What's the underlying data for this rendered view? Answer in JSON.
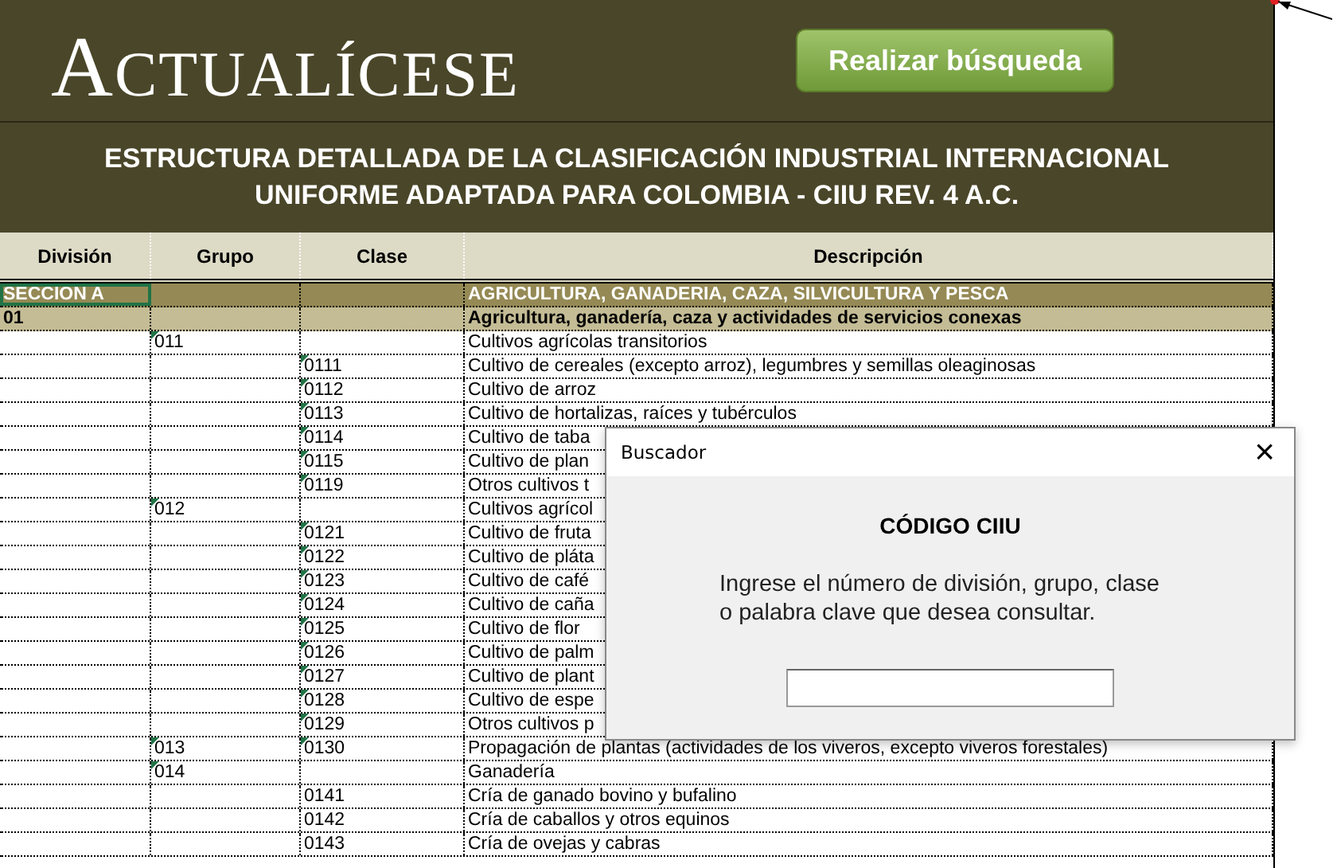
{
  "header": {
    "logo": "ACTUALÍCESE",
    "search_button": "Realizar búsqueda",
    "title_lines": [
      "ESTRUCTURA DETALLADA DE LA CLASIFICACIÓN INDUSTRIAL INTERNACIONAL",
      "UNIFORME ADAPTADA PARA COLOMBIA - CIIU REV. 4 A.C."
    ]
  },
  "table": {
    "columns": [
      "División",
      "Grupo",
      "Clase",
      "Descripción"
    ],
    "rows": [
      {
        "kind": "section",
        "division": "SECCION A",
        "grupo": "",
        "clase": "",
        "descripcion": "AGRICULTURA, GANADERIA, CAZA, SILVICULTURA Y PESCA",
        "grupo_flag": false,
        "clase_flag": false,
        "selected": true
      },
      {
        "kind": "division",
        "division": "01",
        "grupo": "",
        "clase": "",
        "descripcion": "Agricultura, ganadería, caza y actividades de servicios conexas",
        "grupo_flag": false,
        "clase_flag": false,
        "selected": false
      },
      {
        "kind": "item",
        "division": "",
        "grupo": "011",
        "clase": "",
        "descripcion": "Cultivos agrícolas transitorios",
        "grupo_flag": true,
        "clase_flag": false,
        "selected": false
      },
      {
        "kind": "item",
        "division": "",
        "grupo": "",
        "clase": "0111",
        "descripcion": "Cultivo de cereales (excepto arroz), legumbres y semillas oleaginosas",
        "grupo_flag": false,
        "clase_flag": true,
        "selected": false
      },
      {
        "kind": "item",
        "division": "",
        "grupo": "",
        "clase": "0112",
        "descripcion": "Cultivo de arroz",
        "grupo_flag": false,
        "clase_flag": true,
        "selected": false
      },
      {
        "kind": "item",
        "division": "",
        "grupo": "",
        "clase": "0113",
        "descripcion": "Cultivo de hortalizas, raíces y tubérculos",
        "grupo_flag": false,
        "clase_flag": true,
        "selected": false
      },
      {
        "kind": "item",
        "division": "",
        "grupo": "",
        "clase": "0114",
        "descripcion": "Cultivo de taba",
        "grupo_flag": false,
        "clase_flag": true,
        "selected": false
      },
      {
        "kind": "item",
        "division": "",
        "grupo": "",
        "clase": "0115",
        "descripcion": "Cultivo de plan",
        "grupo_flag": false,
        "clase_flag": true,
        "selected": false
      },
      {
        "kind": "item",
        "division": "",
        "grupo": "",
        "clase": "0119",
        "descripcion": "Otros cultivos t",
        "grupo_flag": false,
        "clase_flag": true,
        "selected": false
      },
      {
        "kind": "item",
        "division": "",
        "grupo": "012",
        "clase": "",
        "descripcion": "Cultivos agrícol",
        "grupo_flag": true,
        "clase_flag": false,
        "selected": false
      },
      {
        "kind": "item",
        "division": "",
        "grupo": "",
        "clase": "0121",
        "descripcion": "Cultivo de fruta",
        "grupo_flag": false,
        "clase_flag": true,
        "selected": false
      },
      {
        "kind": "item",
        "division": "",
        "grupo": "",
        "clase": "0122",
        "descripcion": "Cultivo de pláta",
        "grupo_flag": false,
        "clase_flag": true,
        "selected": false
      },
      {
        "kind": "item",
        "division": "",
        "grupo": "",
        "clase": "0123",
        "descripcion": "Cultivo de café",
        "grupo_flag": false,
        "clase_flag": true,
        "selected": false
      },
      {
        "kind": "item",
        "division": "",
        "grupo": "",
        "clase": "0124",
        "descripcion": "Cultivo de caña",
        "grupo_flag": false,
        "clase_flag": true,
        "selected": false
      },
      {
        "kind": "item",
        "division": "",
        "grupo": "",
        "clase": "0125",
        "descripcion": "Cultivo de flor",
        "grupo_flag": false,
        "clase_flag": true,
        "selected": false
      },
      {
        "kind": "item",
        "division": "",
        "grupo": "",
        "clase": "0126",
        "descripcion": "Cultivo de palm",
        "grupo_flag": false,
        "clase_flag": true,
        "selected": false
      },
      {
        "kind": "item",
        "division": "",
        "grupo": "",
        "clase": "0127",
        "descripcion": "Cultivo de plant",
        "grupo_flag": false,
        "clase_flag": true,
        "selected": false
      },
      {
        "kind": "item",
        "division": "",
        "grupo": "",
        "clase": "0128",
        "descripcion": "Cultivo de espe",
        "grupo_flag": false,
        "clase_flag": true,
        "selected": false
      },
      {
        "kind": "item",
        "division": "",
        "grupo": "",
        "clase": "0129",
        "descripcion": "Otros cultivos p",
        "grupo_flag": false,
        "clase_flag": true,
        "selected": false
      },
      {
        "kind": "item",
        "division": "",
        "grupo": "013",
        "clase": "0130",
        "descripcion": "Propagación de plantas (actividades de los viveros, excepto viveros forestales)",
        "grupo_flag": true,
        "clase_flag": true,
        "selected": false
      },
      {
        "kind": "item",
        "division": "",
        "grupo": "014",
        "clase": "",
        "descripcion": "Ganadería",
        "grupo_flag": true,
        "clase_flag": false,
        "selected": false
      },
      {
        "kind": "item",
        "division": "",
        "grupo": "",
        "clase": "0141",
        "descripcion": "Cría de ganado bovino y bufalino",
        "grupo_flag": false,
        "clase_flag": false,
        "selected": false
      },
      {
        "kind": "item",
        "division": "",
        "grupo": "",
        "clase": "0142",
        "descripcion": "Cría de caballos y otros equinos",
        "grupo_flag": false,
        "clase_flag": false,
        "selected": false
      },
      {
        "kind": "item",
        "division": "",
        "grupo": "",
        "clase": "0143",
        "descripcion": "Cría de ovejas y cabras",
        "grupo_flag": false,
        "clase_flag": false,
        "selected": false
      }
    ]
  },
  "dialog": {
    "title": "Buscador",
    "close": "×",
    "heading": "CÓDIGO CIIU",
    "instruction_lines": [
      "Ingrese el número de división, grupo, clase",
      "o palabra clave que desea consultar."
    ]
  }
}
